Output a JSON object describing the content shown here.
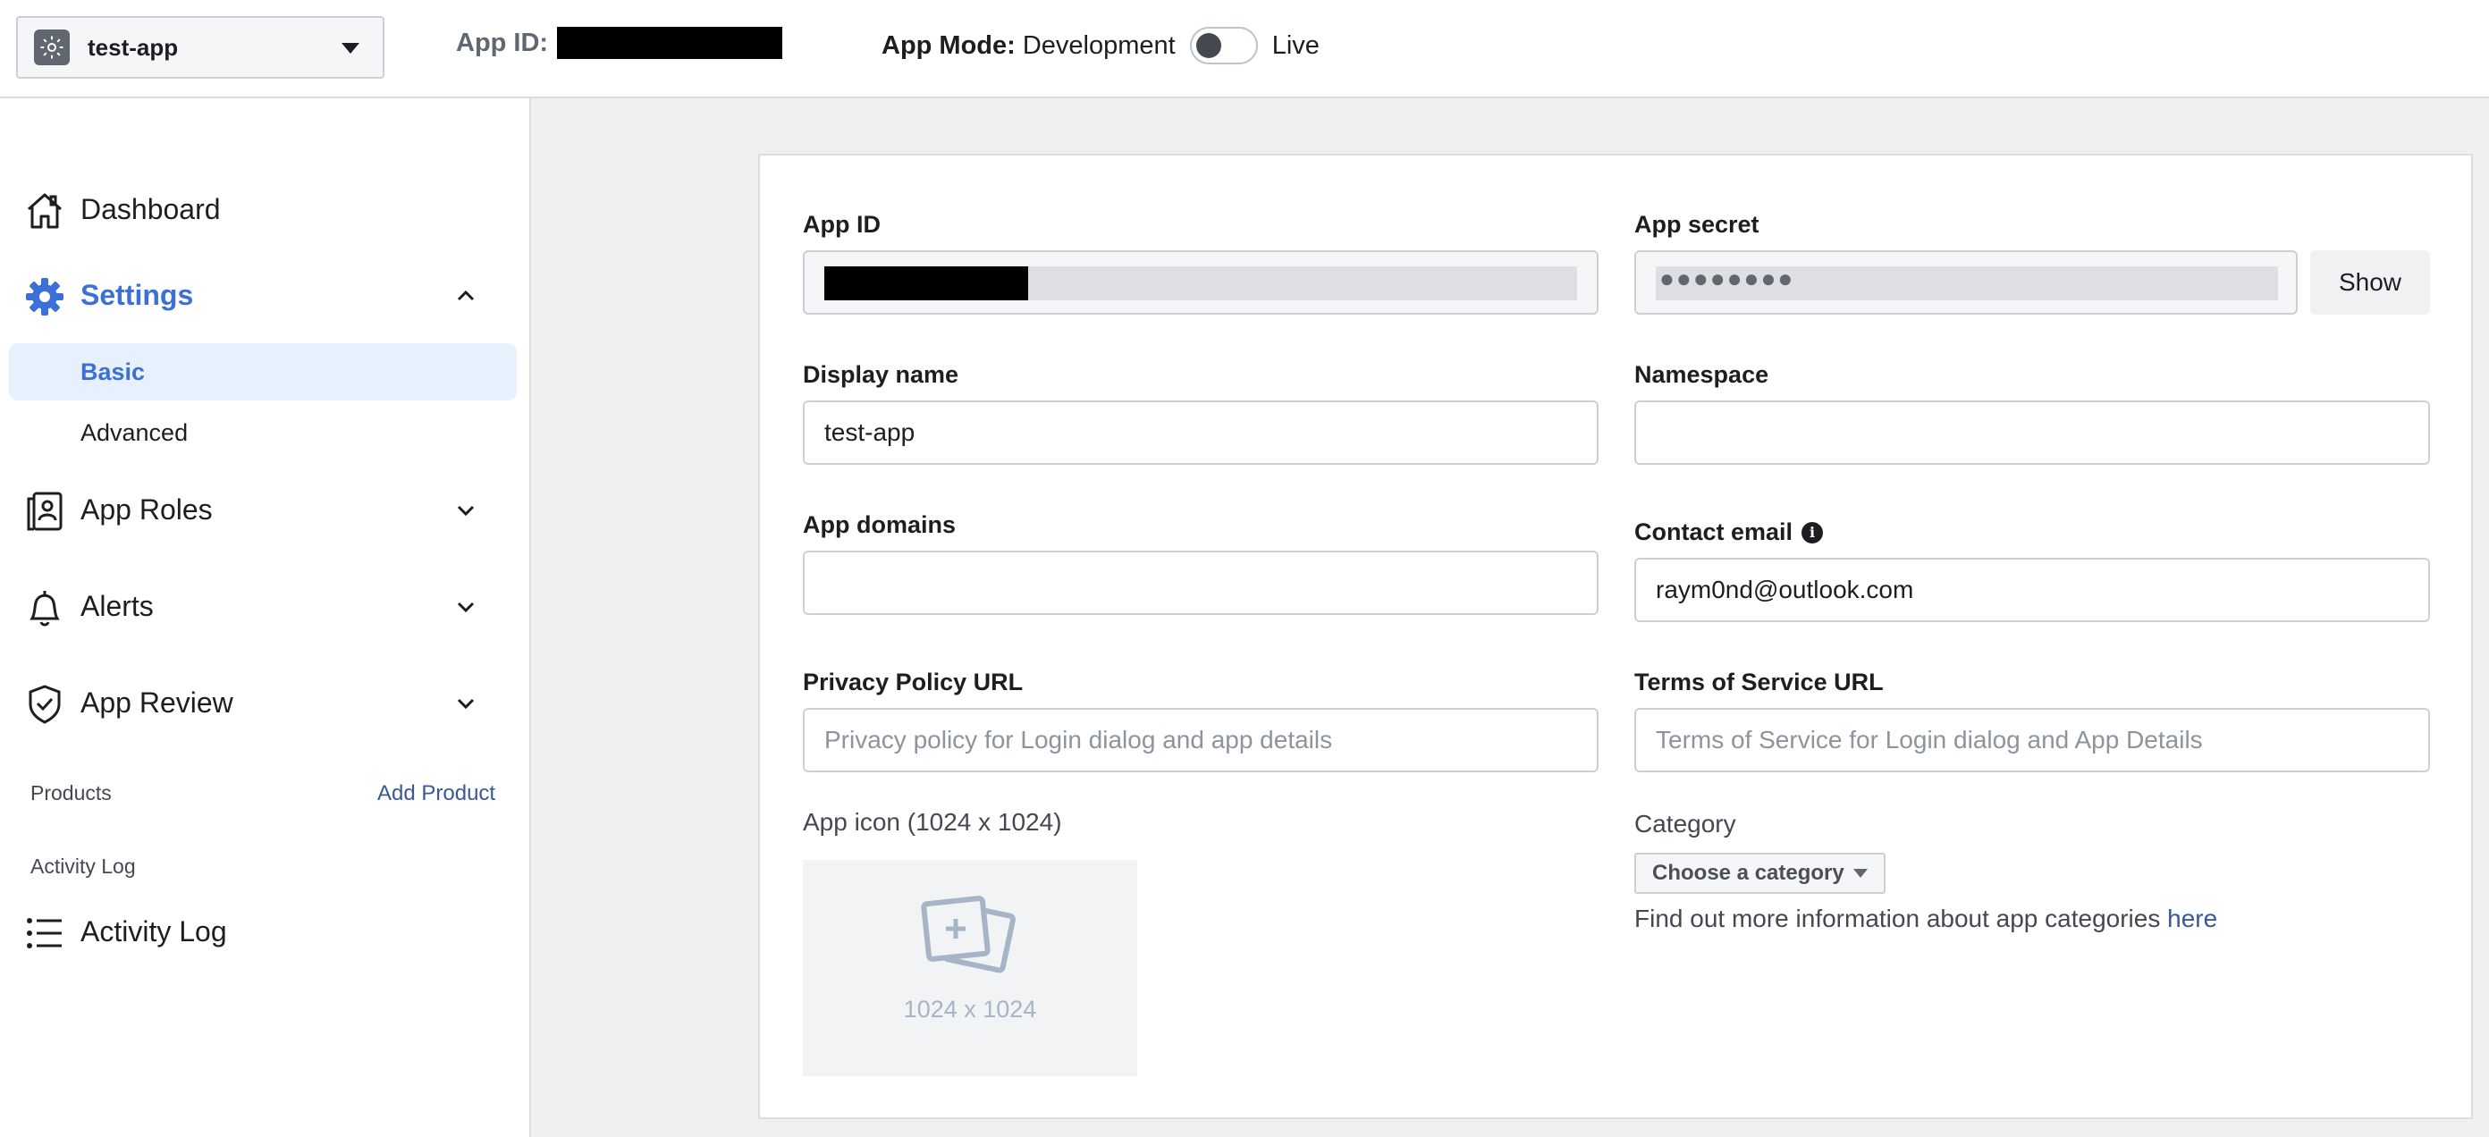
{
  "topbar": {
    "app_name": "test-app",
    "app_id_label": "App ID:",
    "app_mode_label": "App Mode:",
    "mode_development": "Development",
    "mode_live": "Live"
  },
  "sidebar": {
    "dashboard": "Dashboard",
    "settings": "Settings",
    "settings_sub": [
      "Basic",
      "Advanced"
    ],
    "app_roles": "App Roles",
    "alerts": "Alerts",
    "app_review": "App Review",
    "products_label": "Products",
    "add_product": "Add Product",
    "activity_log_section": "Activity Log",
    "activity_log": "Activity Log"
  },
  "form": {
    "app_id_label": "App ID",
    "app_secret_label": "App secret",
    "app_secret_masked": "●●●●●●●●",
    "show_button": "Show",
    "display_name_label": "Display name",
    "display_name_value": "test-app",
    "namespace_label": "Namespace",
    "app_domains_label": "App domains",
    "contact_email_label": "Contact email",
    "contact_email_value": "raym0nd@outlook.com",
    "privacy_label": "Privacy Policy URL",
    "privacy_placeholder": "Privacy policy for Login dialog and app details",
    "tos_label": "Terms of Service URL",
    "tos_placeholder": "Terms of Service for Login dialog and App Details",
    "app_icon_label": "App icon (1024 x 1024)",
    "app_icon_dim": "1024 x 1024",
    "category_label": "Category",
    "category_select": "Choose a category",
    "category_help": "Find out more information about app categories",
    "category_help_link": "here"
  },
  "colors": {
    "accent": "#3b70d6",
    "link": "#385898",
    "active_bg": "#e7f0fd"
  }
}
